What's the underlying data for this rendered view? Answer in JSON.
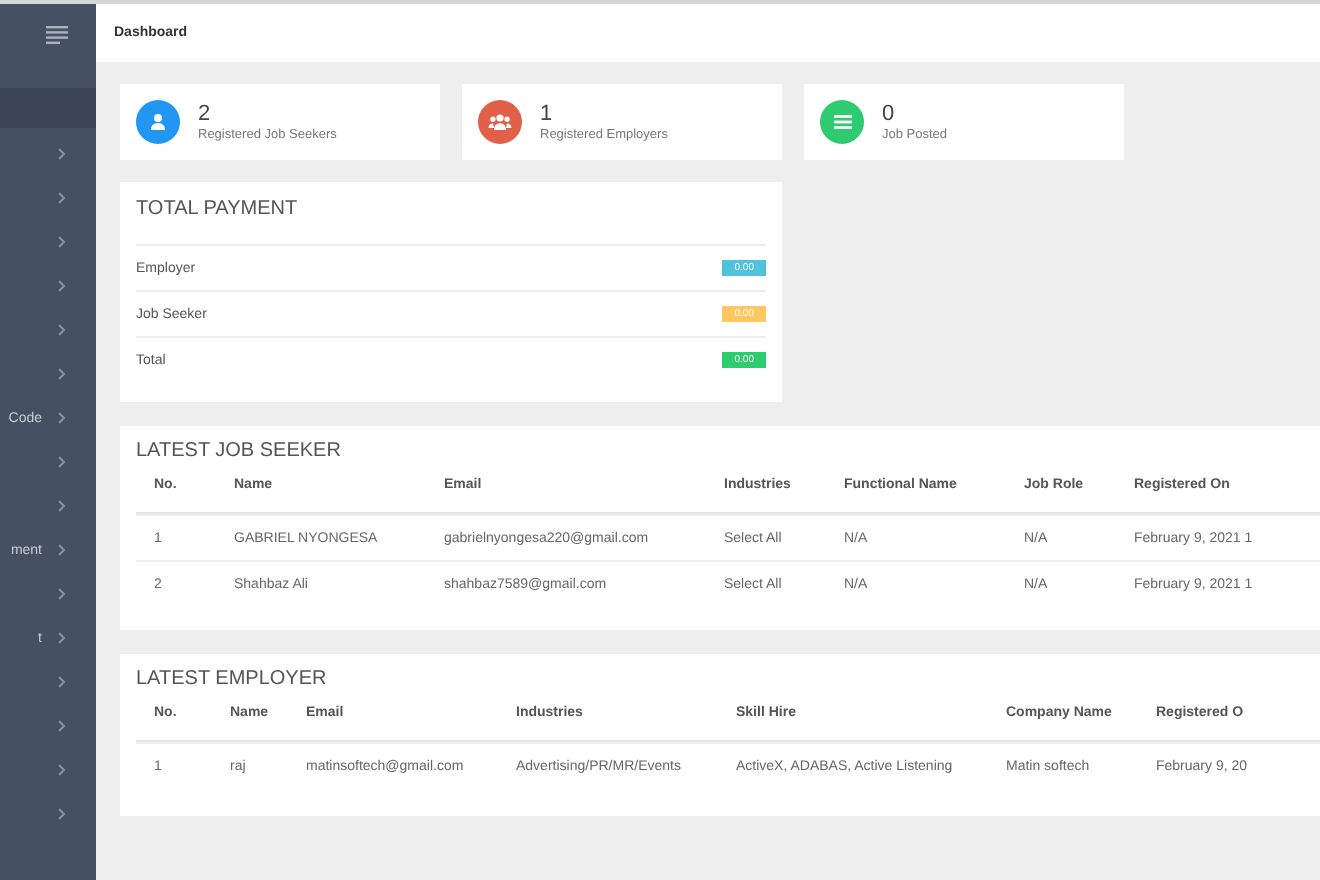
{
  "header": {
    "title": "Dashboard"
  },
  "sidebar": {
    "items": [
      {
        "selected": true
      },
      {
        "selected": false
      },
      {
        "selected": false
      },
      {
        "selected": false
      },
      {
        "selected": false
      },
      {
        "selected": false
      },
      {
        "selected": false
      },
      {
        "label": "Code",
        "selected": false
      },
      {
        "selected": false
      },
      {
        "selected": false
      },
      {
        "label": "ment",
        "selected": false
      },
      {
        "selected": false
      },
      {
        "label": "t",
        "selected": false
      },
      {
        "selected": false
      },
      {
        "selected": false
      },
      {
        "selected": false
      },
      {
        "selected": false
      }
    ]
  },
  "stats": [
    {
      "count": "2",
      "label": "Registered Job Seekers",
      "color": "#2196f3"
    },
    {
      "count": "1",
      "label": "Registered Employers",
      "color": "#e0604a"
    },
    {
      "count": "0",
      "label": "Job Posted",
      "color": "#2ecc71"
    }
  ],
  "total_payment": {
    "title": "TOTAL PAYMENT",
    "rows": [
      {
        "label": "Employer",
        "amount": "0.00",
        "color": "#4fc3db"
      },
      {
        "label": "Job Seeker",
        "amount": "0.00",
        "color": "#ffc75f"
      },
      {
        "label": "Total",
        "amount": "0.00",
        "color": "#2ecc71"
      }
    ]
  },
  "latest_job_seeker": {
    "title": "LATEST JOB SEEKER",
    "columns": [
      "No.",
      "Name",
      "Email",
      "Industries",
      "Functional Name",
      "Job Role",
      "Registered On"
    ],
    "rows": [
      [
        "1",
        "GABRIEL NYONGESA",
        "gabrielnyongesa220@gmail.com",
        "Select All",
        "N/A",
        "N/A",
        "February 9, 2021 1"
      ],
      [
        "2",
        "Shahbaz Ali",
        "shahbaz7589@gmail.com",
        "Select All",
        "N/A",
        "N/A",
        "February 9, 2021 1"
      ]
    ]
  },
  "latest_employer": {
    "title": "LATEST EMPLOYER",
    "columns": [
      "No.",
      "Name",
      "Email",
      "Industries",
      "Skill Hire",
      "Company Name",
      "Registered O"
    ],
    "rows": [
      [
        "1",
        "raj",
        "matinsoftech@gmail.com",
        "Advertising/PR/MR/Events",
        "ActiveX, ADABAS, Active Listening",
        "Matin softech",
        "February 9, 20"
      ]
    ]
  }
}
